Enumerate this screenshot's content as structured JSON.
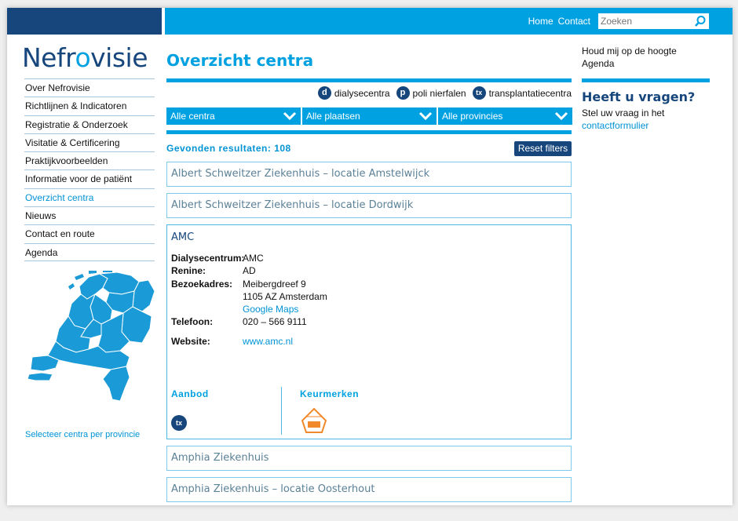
{
  "topnav": {
    "home": "Home",
    "contact": "Contact",
    "search_placeholder": "Zoeken"
  },
  "logo": {
    "part1": "Nefr",
    "part2": "o",
    "part3": "visie"
  },
  "sidebar": {
    "items": [
      {
        "label": "Over Nefrovisie"
      },
      {
        "label": "Richtlijnen & Indicatoren"
      },
      {
        "label": "Registratie & Onderzoek"
      },
      {
        "label": "Visitatie & Certificering"
      },
      {
        "label": "Praktijkvoorbeelden"
      },
      {
        "label": "Informatie voor de patiënt"
      },
      {
        "label": "Overzicht centra"
      },
      {
        "label": "Nieuws"
      },
      {
        "label": "Contact en route"
      },
      {
        "label": "Agenda"
      }
    ],
    "map_link": "Selecteer centra per provincie"
  },
  "main": {
    "title": "Overzicht centra",
    "legend": [
      {
        "badge": "d",
        "label": "dialysecentra"
      },
      {
        "badge": "p",
        "label": "poli nierfalen"
      },
      {
        "badge": "tx",
        "label": "transplantatiecentra"
      }
    ],
    "filters": [
      "Alle centra",
      "Alle plaatsen",
      "Alle provincies"
    ],
    "results": "Gevonden resultaten: 108",
    "reset": "Reset filters",
    "cards": [
      "Albert Schweitzer Ziekenhuis – locatie Amstelwijck",
      "Albert Schweitzer Ziekenhuis – locatie Dordwijk",
      "Amphia Ziekenhuis",
      "Amphia Ziekenhuis – locatie Oosterhout"
    ],
    "open_card": {
      "name": "AMC",
      "dialysecentrum_label": "Dialysecentrum:",
      "dialysecentrum": "AMC",
      "renine_label": "Renine:",
      "renine": "AD",
      "adres_label": "Bezoekadres:",
      "adres1": "Meibergdreef 9",
      "adres2": "1105 AZ Amsterdam",
      "maps": "Google Maps",
      "telefoon_label": "Telefoon:",
      "telefoon": "020 – 566 9111",
      "website_label": "Website:",
      "website": "www.amc.nl",
      "aanbod": "Aanbod",
      "keurmerken": "Keurmerken",
      "tx": "tx"
    }
  },
  "right": {
    "link1": "Houd mij op de hoogte",
    "link2": "Agenda",
    "heading": "Heeft u vragen?",
    "ask": "Stel uw vraag in het",
    "ask_link": "contactformulier"
  }
}
